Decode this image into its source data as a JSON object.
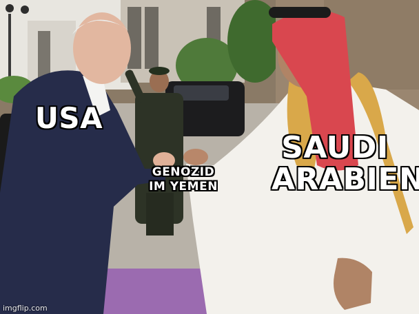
{
  "meme": {
    "label_left": "USA",
    "label_center_line1": "GENOZID",
    "label_center_line2": "IM YEMEN",
    "label_right_line1": "SAUDI",
    "label_right_line2": "ARABIEN",
    "watermark": "imgflip.com"
  }
}
